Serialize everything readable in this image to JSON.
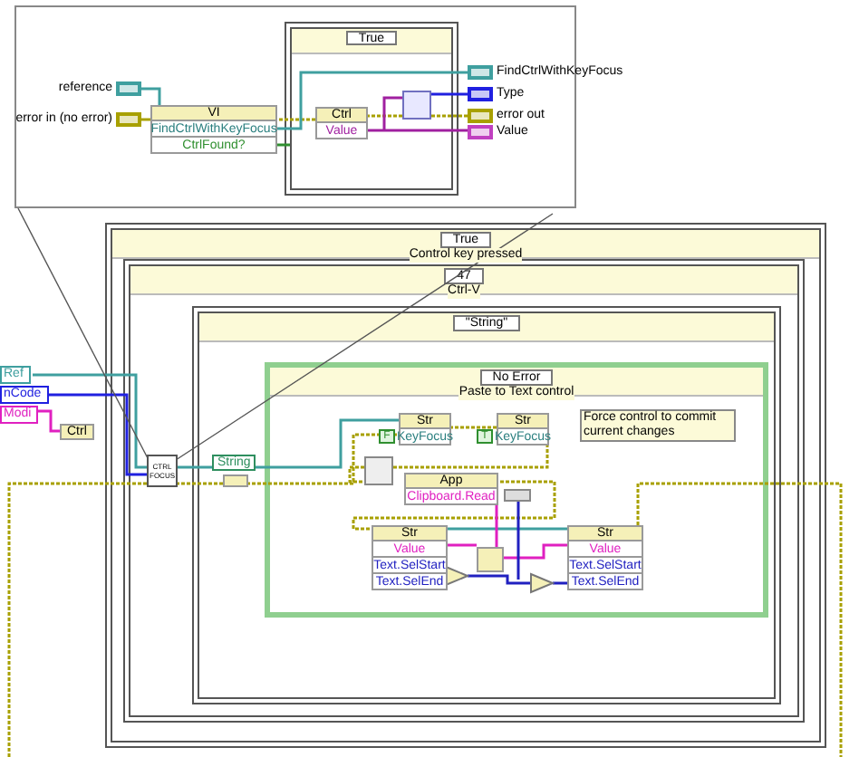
{
  "inset": {
    "inputs": [
      {
        "label": "reference",
        "color": "#3f9f9f"
      },
      {
        "label": "error in (no error)",
        "color": "#a8a000"
      }
    ],
    "vi_node": {
      "class": "VI",
      "properties": [
        {
          "label": "FindCtrlWithKeyFocus",
          "color": "#2a7f7f"
        },
        {
          "label": "CtrlFound?",
          "color": "#2f8f2f"
        }
      ]
    },
    "case": {
      "selector": "True"
    },
    "ctrl_node": {
      "class": "Ctrl",
      "properties": [
        {
          "label": "Value",
          "color": "#a020a0"
        }
      ]
    },
    "outputs": [
      {
        "label": "FindCtrlWithKeyFocus",
        "color": "#3f9f9f"
      },
      {
        "label": "Type",
        "color": "#2020e0"
      },
      {
        "label": "error out",
        "color": "#a8a000"
      },
      {
        "label": "Value",
        "color": "#c040c0"
      }
    ]
  },
  "main": {
    "cases": [
      {
        "kind": "case",
        "selector": "True",
        "label": "Control key pressed"
      },
      {
        "kind": "case",
        "selector": "47",
        "label": "Ctrl-V"
      },
      {
        "kind": "case",
        "selector": "\"String\""
      },
      {
        "kind": "error_case",
        "selector": "No Error",
        "label": "Paste to Text control"
      }
    ],
    "inputs": [
      {
        "label": "Ref",
        "color": "#3f9f9f"
      },
      {
        "label": "nCode",
        "color": "#2020e0"
      },
      {
        "label": "Modi",
        "color": "#e020c0"
      }
    ],
    "unbundle": "Ctrl",
    "subvi": "CTRL FOCUS",
    "string_constant": "String",
    "key_focus_nodes": [
      {
        "class": "Str",
        "property": "KeyFocus",
        "constant": "F"
      },
      {
        "class": "Str",
        "property": "KeyFocus",
        "constant": "T"
      }
    ],
    "comment": "Force control to commit current changes",
    "app_node": {
      "class": "App",
      "properties": [
        {
          "label": "Clipboard.Read",
          "color": "#e020c0"
        }
      ]
    },
    "str_nodes": [
      {
        "class": "Str",
        "properties": [
          {
            "label": "Value",
            "color": "#e020c0"
          },
          {
            "label": "Text.SelStart",
            "color": "#2020c0"
          },
          {
            "label": "Text.SelEnd",
            "color": "#2020c0"
          }
        ]
      },
      {
        "class": "Str",
        "properties": [
          {
            "label": "Value",
            "color": "#e020c0"
          },
          {
            "label": "Text.SelStart",
            "color": "#2020c0"
          },
          {
            "label": "Text.SelEnd",
            "color": "#2020c0"
          }
        ]
      }
    ]
  }
}
